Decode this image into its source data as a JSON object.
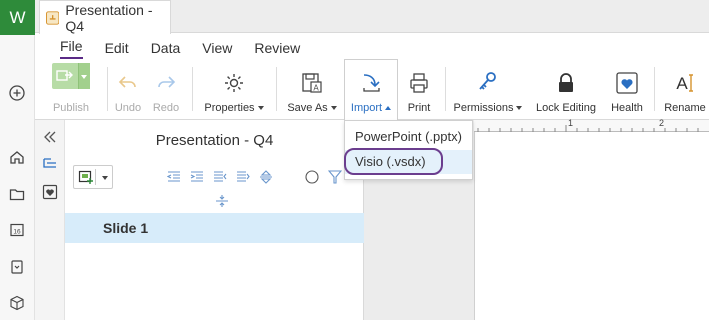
{
  "app": {
    "badge": "W",
    "document_title": "Presentation - Q4"
  },
  "menu": {
    "items": [
      "File",
      "Edit",
      "Data",
      "View",
      "Review"
    ],
    "active": "File"
  },
  "ribbon": {
    "publish": "Publish",
    "undo": "Undo",
    "redo": "Redo",
    "properties": "Properties",
    "save_as": "Save As",
    "import": "Import",
    "print": "Print",
    "permissions": "Permissions",
    "lock_editing": "Lock Editing",
    "health": "Health",
    "rename": "Rename"
  },
  "import_menu": {
    "options": [
      "PowerPoint (.pptx)",
      "Visio (.vsdx)"
    ],
    "highlighted": "Visio (.vsdx)"
  },
  "pane": {
    "title": "Presentation - Q4",
    "slides": [
      "Slide 1"
    ]
  },
  "ruler": {
    "marks": [
      "1",
      "2"
    ]
  },
  "colors": {
    "brand_green": "#2e8b3a",
    "accent_purple": "#5a2a86",
    "import_blue": "#2a6fc2",
    "selection_blue": "#d7ecfa"
  }
}
